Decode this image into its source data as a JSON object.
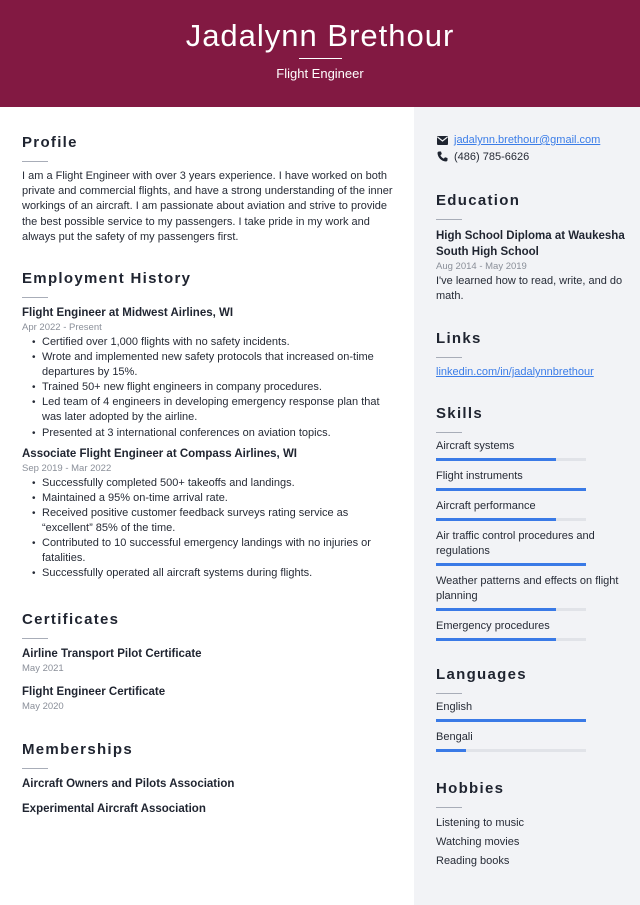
{
  "header": {
    "name": "Jadalynn Brethour",
    "title": "Flight Engineer",
    "background_color": "#821942"
  },
  "profile": {
    "heading": "Profile",
    "text": "I am a Flight Engineer with over 3 years experience. I have worked on both private and commercial flights, and have a strong understanding of the inner workings of an aircraft. I am passionate about aviation and strive to provide the best possible service to my passengers. I take pride in my work and always put the safety of my passengers first."
  },
  "employment": {
    "heading": "Employment History",
    "jobs": [
      {
        "title": "Flight Engineer at Midwest Airlines, WI",
        "dates": "Apr 2022 - Present",
        "bullets": [
          "Certified over 1,000 flights with no safety incidents.",
          "Wrote and implemented new safety protocols that increased on-time departures by 15%.",
          "Trained 50+ new flight engineers in company procedures.",
          "Led team of 4 engineers in developing emergency response plan that was later adopted by the airline.",
          "Presented at 3 international conferences on aviation topics."
        ]
      },
      {
        "title": "Associate Flight Engineer at Compass Airlines, WI",
        "dates": "Sep 2019 - Mar 2022",
        "bullets": [
          "Successfully completed 500+ takeoffs and landings.",
          "Maintained a 95% on-time arrival rate.",
          "Received positive customer feedback surveys rating service as “excellent” 85% of the time.",
          "Contributed to 10 successful emergency landings with no injuries or fatalities.",
          "Successfully operated all aircraft systems during flights."
        ]
      }
    ]
  },
  "certificates": {
    "heading": "Certificates",
    "items": [
      {
        "name": "Airline Transport Pilot Certificate",
        "date": "May 2021"
      },
      {
        "name": "Flight Engineer Certificate",
        "date": "May 2020"
      }
    ]
  },
  "memberships": {
    "heading": "Memberships",
    "items": [
      "Aircraft Owners and Pilots Association",
      "Experimental Aircraft Association"
    ]
  },
  "contact": {
    "email": "jadalynn.brethour@gmail.com",
    "phone": "(486) 785-6626",
    "email_icon": "envelope-icon",
    "phone_icon": "phone-icon"
  },
  "education": {
    "heading": "Education",
    "degree": "High School Diploma at Waukesha South High School",
    "dates": "Aug 2014 - May 2019",
    "description": "I've learned how to read, write, and do math."
  },
  "links": {
    "heading": "Links",
    "items": [
      "linkedin.com/in/jadalynnbrethour"
    ]
  },
  "skills": {
    "heading": "Skills",
    "items": [
      {
        "name": "Aircraft systems",
        "level": 0.8
      },
      {
        "name": "Flight instruments",
        "level": 1.0
      },
      {
        "name": "Aircraft performance",
        "level": 0.8
      },
      {
        "name": "Air traffic control procedures and regulations",
        "level": 1.0
      },
      {
        "name": "Weather patterns and effects on flight planning",
        "level": 0.8
      },
      {
        "name": "Emergency procedures",
        "level": 0.8
      }
    ]
  },
  "languages": {
    "heading": "Languages",
    "items": [
      {
        "name": "English",
        "level": 1.0
      },
      {
        "name": "Bengali",
        "level": 0.2
      }
    ]
  },
  "hobbies": {
    "heading": "Hobbies",
    "items": [
      "Listening to music",
      "Watching movies",
      "Reading books"
    ]
  },
  "colors": {
    "accent_bar": "#3a7ae6",
    "link": "#3b7de8",
    "sidebar_bg": "#f2f3f6"
  }
}
